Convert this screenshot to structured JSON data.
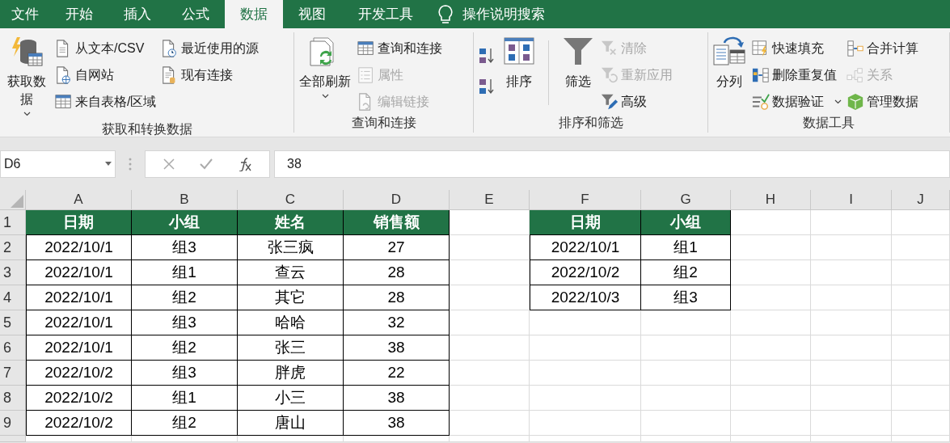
{
  "tabs": [
    {
      "label": "文件",
      "selected": false
    },
    {
      "label": "开始",
      "selected": false
    },
    {
      "label": "插入",
      "selected": false
    },
    {
      "label": "公式",
      "selected": false
    },
    {
      "label": "数据",
      "selected": true
    },
    {
      "label": "视图",
      "selected": false
    },
    {
      "label": "开发工具",
      "selected": false
    }
  ],
  "tell_me": "操作说明搜索",
  "ribbon_groups": [
    {
      "label": "获取和转换数据",
      "controls": [
        {
          "kind": "large",
          "label": "获取数据",
          "menu": true
        },
        {
          "kind": "stack",
          "items": [
            {
              "label": "从文本/CSV",
              "disabled": false
            },
            {
              "label": "自网站",
              "disabled": false
            },
            {
              "label": "来自表格/区域",
              "disabled": false
            }
          ]
        },
        {
          "kind": "stack",
          "items": [
            {
              "label": "最近使用的源",
              "disabled": false
            },
            {
              "label": "现有连接",
              "disabled": false
            }
          ]
        }
      ]
    },
    {
      "label": "查询和连接",
      "controls": [
        {
          "kind": "large",
          "label": "全部刷新",
          "menu": true
        },
        {
          "kind": "stack",
          "items": [
            {
              "label": "查询和连接",
              "disabled": false
            },
            {
              "label": "属性",
              "disabled": true
            },
            {
              "label": "编辑链接",
              "disabled": true
            }
          ]
        }
      ]
    },
    {
      "label": "排序和筛选",
      "controls": [
        {
          "kind": "sort_buttons"
        },
        {
          "kind": "large",
          "label": "排序",
          "menu": false
        },
        {
          "kind": "divider"
        },
        {
          "kind": "large",
          "label": "筛选",
          "menu": false
        },
        {
          "kind": "stack",
          "items": [
            {
              "label": "清除",
              "disabled": true
            },
            {
              "label": "重新应用",
              "disabled": true
            },
            {
              "label": "高级",
              "disabled": false
            }
          ]
        }
      ]
    },
    {
      "label": "数据工具",
      "controls": [
        {
          "kind": "large",
          "label": "分列",
          "menu": false
        },
        {
          "kind": "stack",
          "items": [
            {
              "label": "快速填充",
              "disabled": false
            },
            {
              "label": "删除重复值",
              "disabled": false
            },
            {
              "label": "数据验证",
              "disabled": false,
              "menu": true
            }
          ]
        },
        {
          "kind": "stack",
          "items": [
            {
              "label": "合并计算",
              "disabled": false
            },
            {
              "label": "关系",
              "disabled": true
            },
            {
              "label": "管理数据",
              "disabled": false
            }
          ]
        }
      ]
    }
  ],
  "formula_bar": {
    "name_box": "D6",
    "value": "38"
  },
  "columns": [
    "A",
    "B",
    "C",
    "D",
    "E",
    "F",
    "G",
    "H",
    "I",
    "J"
  ],
  "row_numbers": [
    "1",
    "2",
    "3",
    "4",
    "5",
    "6",
    "7",
    "8",
    "9"
  ],
  "tables": [
    {
      "headers": [
        "日期",
        "小组",
        "姓名",
        "销售额"
      ],
      "rows": [
        [
          "2022/10/1",
          "组3",
          "张三疯",
          "27"
        ],
        [
          "2022/10/1",
          "组1",
          "查云",
          "28"
        ],
        [
          "2022/10/1",
          "组2",
          "其它",
          "28"
        ],
        [
          "2022/10/1",
          "组3",
          "哈哈",
          "32"
        ],
        [
          "2022/10/1",
          "组2",
          "张三",
          "38"
        ],
        [
          "2022/10/2",
          "组3",
          "胖虎",
          "22"
        ],
        [
          "2022/10/2",
          "组1",
          "小三",
          "38"
        ],
        [
          "2022/10/2",
          "组2",
          "唐山",
          "38"
        ]
      ]
    },
    {
      "headers": [
        "日期",
        "小组"
      ],
      "rows": [
        [
          "2022/10/1",
          "组1"
        ],
        [
          "2022/10/2",
          "组2"
        ],
        [
          "2022/10/3",
          "组3"
        ]
      ]
    }
  ]
}
